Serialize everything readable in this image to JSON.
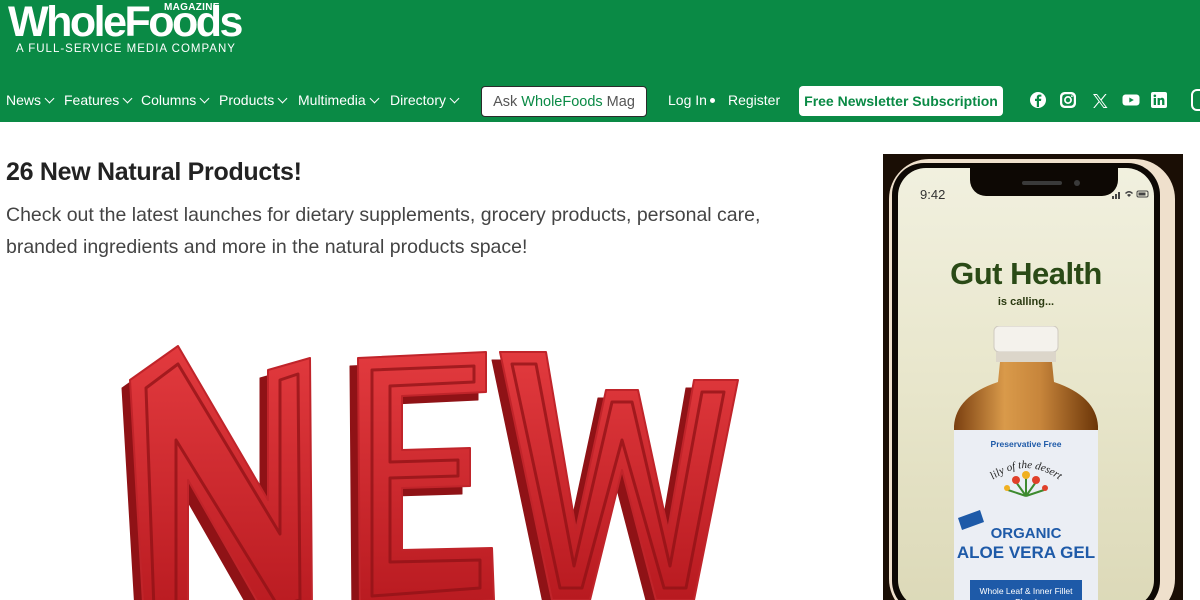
{
  "logo": {
    "main": "WholeFoods",
    "magazine": "MAGAZINE",
    "tagline": "A FULL-SERVICE MEDIA COMPANY"
  },
  "nav": {
    "items": [
      {
        "label": "News"
      },
      {
        "label": "Features"
      },
      {
        "label": "Columns"
      },
      {
        "label": "Products"
      },
      {
        "label": "Multimedia"
      },
      {
        "label": "Directory"
      }
    ],
    "ask": {
      "part1": "Ask",
      "part2": "WholeFoods",
      "part3": "Mag"
    },
    "login": "Log In",
    "register": "Register",
    "newsletter": "Free Newsletter Subscription"
  },
  "social_icons": [
    "facebook-icon",
    "instagram-icon",
    "x-icon",
    "youtube-icon",
    "linkedin-icon"
  ],
  "article": {
    "title": "26 New Natural Products!",
    "description": "Check out the latest launches for dietary supplements, grocery products, personal care, branded ingredients and more in the natural products space!",
    "hero_word": "NEW"
  },
  "ad": {
    "time": "9:42",
    "headline": "Gut Health",
    "subheadline": "is calling...",
    "preservative": "Preservative Free",
    "brand": "lily of the desert",
    "organic": "ORGANIC",
    "product": "ALOE VERA GEL",
    "blend": "Whole Leaf & Inner Fillet Blend"
  },
  "colors": {
    "brand_green": "#0a8a45",
    "hero_red": "#d4282e",
    "ad_blue": "#1e5aa8",
    "ad_green": "#2a4a16"
  }
}
